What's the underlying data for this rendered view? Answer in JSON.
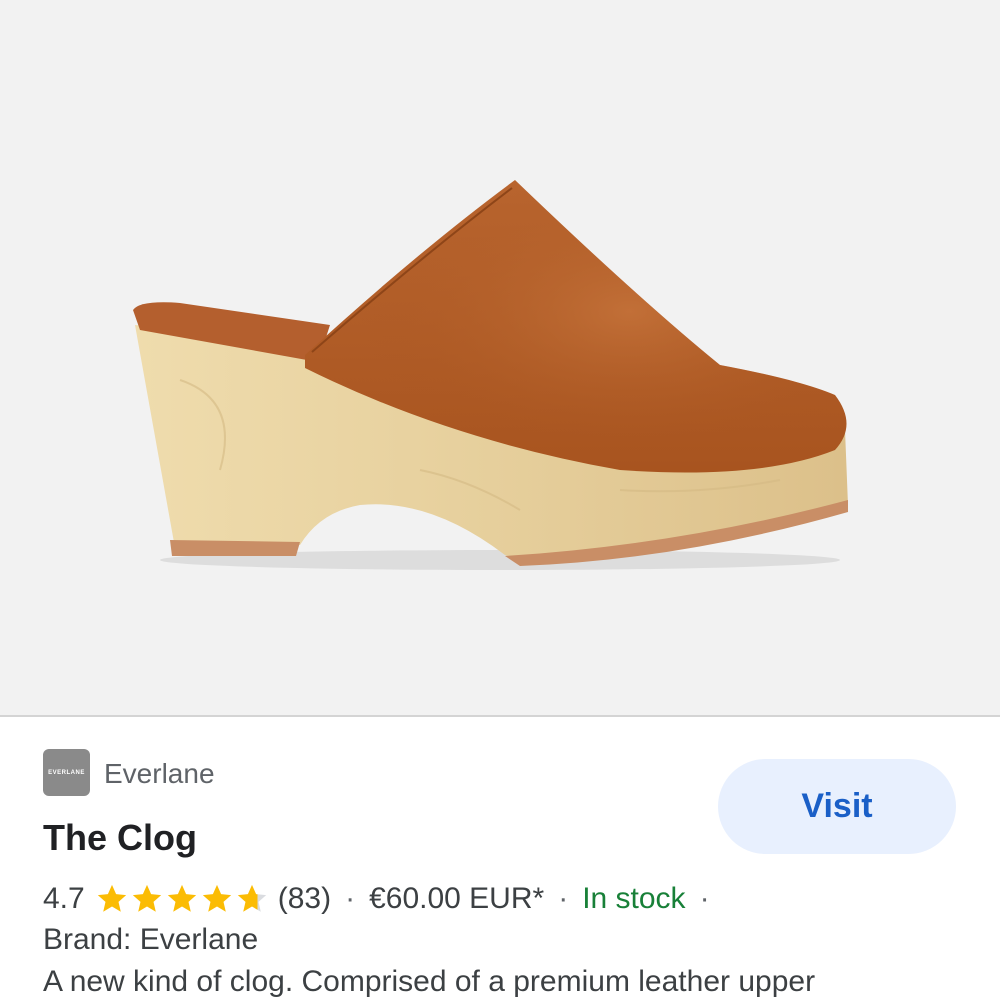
{
  "product_image": {
    "alt": "The Clog",
    "colors": {
      "background": "#f2f2f2",
      "leather": "#b45f2e",
      "wood": "#e4cf9e"
    }
  },
  "merchant": {
    "logo_text": "EVERLANE",
    "name": "Everlane"
  },
  "visit_button": {
    "label": "Visit"
  },
  "product": {
    "title": "The Clog",
    "rating": "4.7",
    "rating_value": 4.7,
    "rating_max": 5,
    "review_count": "(83)",
    "price": "€60.00 EUR*",
    "availability": "In stock",
    "separator": "·",
    "brand_line": "Brand: Everlane",
    "description": "A new kind of clog. Comprised of a premium leather upper"
  },
  "colors": {
    "star": "#fbbc04",
    "star_empty": "#dadce0",
    "visit_bg": "#e8f0fe",
    "visit_text": "#1a5fc7",
    "in_stock": "#188038"
  }
}
